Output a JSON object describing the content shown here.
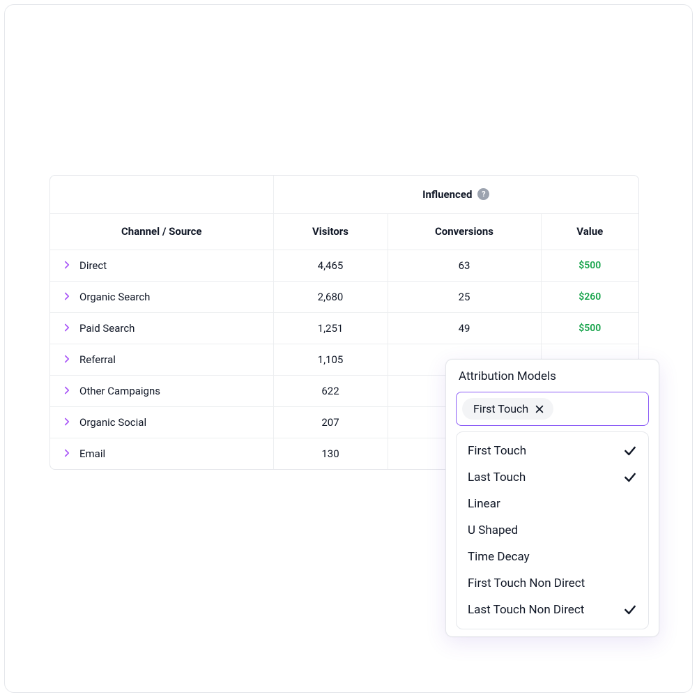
{
  "table": {
    "influenced_label": "Influenced",
    "columns": {
      "channel": "Channel / Source",
      "visitors": "Visitors",
      "conversions": "Conversions",
      "value": "Value"
    },
    "rows": [
      {
        "channel": "Direct",
        "visitors": "4,465",
        "conversions": "63",
        "value": "$500"
      },
      {
        "channel": "Organic Search",
        "visitors": "2,680",
        "conversions": "25",
        "value": "$260"
      },
      {
        "channel": "Paid Search",
        "visitors": "1,251",
        "conversions": "49",
        "value": "$500"
      },
      {
        "channel": "Referral",
        "visitors": "1,105",
        "conversions": "",
        "value": ""
      },
      {
        "channel": "Other Campaigns",
        "visitors": "622",
        "conversions": "",
        "value": ""
      },
      {
        "channel": "Organic Social",
        "visitors": "207",
        "conversions": "",
        "value": ""
      },
      {
        "channel": "Email",
        "visitors": "130",
        "conversions": "",
        "value": ""
      }
    ]
  },
  "dropdown": {
    "title": "Attribution Models",
    "selected_chip": "First Touch",
    "options": [
      {
        "label": "First Touch",
        "checked": true
      },
      {
        "label": "Last Touch",
        "checked": true
      },
      {
        "label": "Linear",
        "checked": false
      },
      {
        "label": "U Shaped",
        "checked": false
      },
      {
        "label": "Time Decay",
        "checked": false
      },
      {
        "label": "First Touch Non Direct",
        "checked": false
      },
      {
        "label": "Last Touch Non Direct",
        "checked": true
      }
    ]
  },
  "colors": {
    "accent": "#8b5cf6",
    "chevron": "#a855f7",
    "value_positive": "#16a34a",
    "border": "#e5e7eb"
  }
}
